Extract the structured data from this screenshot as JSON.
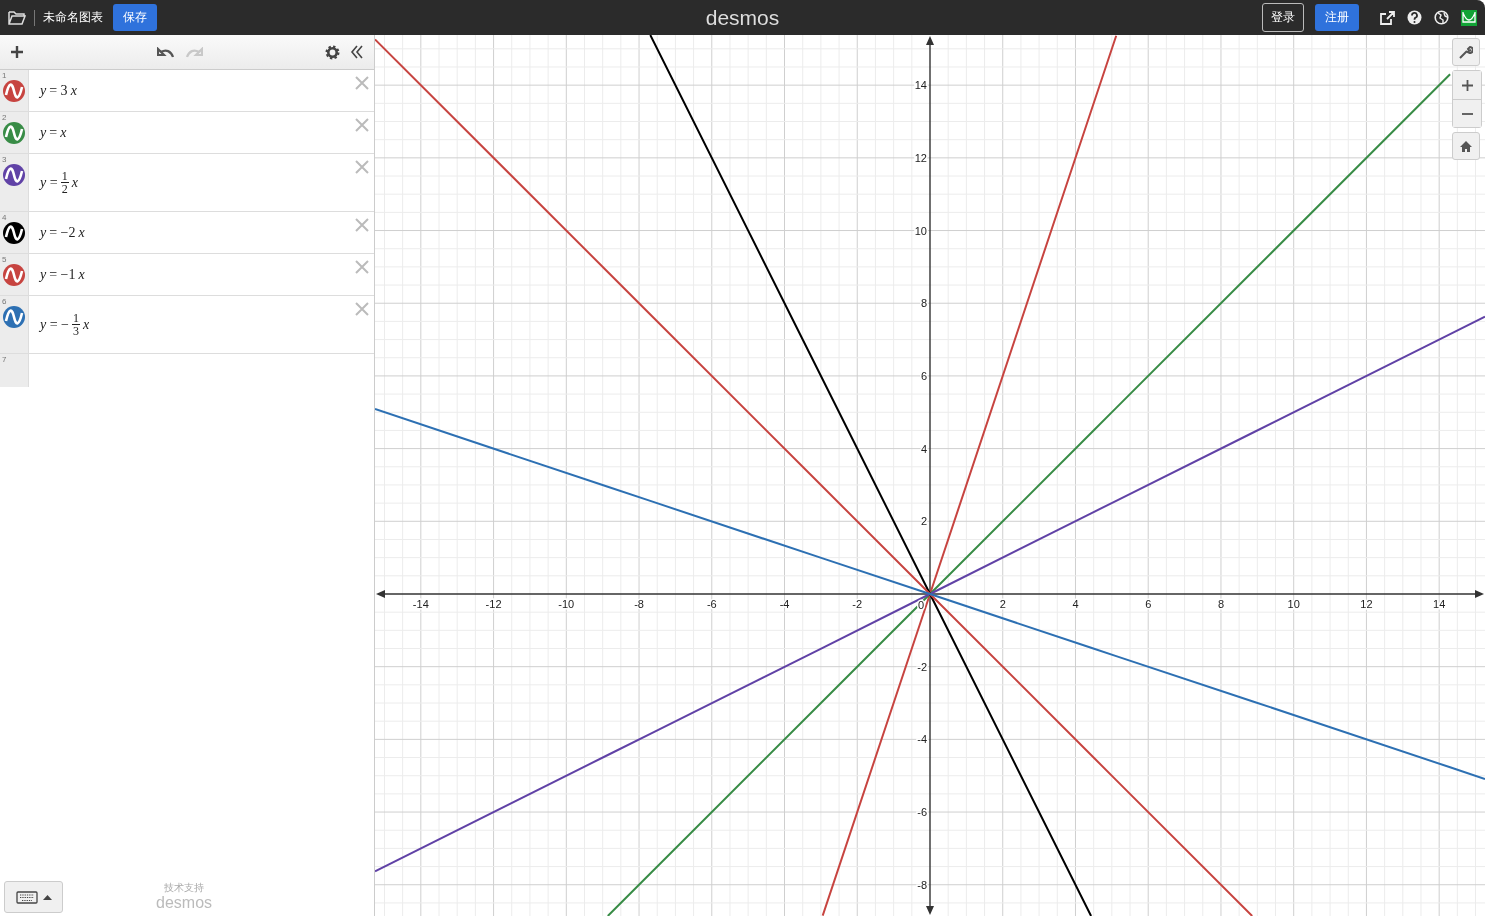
{
  "top_bar": {
    "title": "未命名图表",
    "save_button": "保存",
    "logo": "desmos",
    "login_button": "登录",
    "signup_button": "注册"
  },
  "toolbar": {
    "undo_disabled": false,
    "redo_disabled": true
  },
  "expressions": [
    {
      "index": "1",
      "kind": "plain",
      "color": "#c74440",
      "text": "y = 3x"
    },
    {
      "index": "2",
      "kind": "plain",
      "color": "#388c46",
      "text": "y = x"
    },
    {
      "index": "3",
      "kind": "fraction",
      "color": "#6042a6",
      "prefix": "y =",
      "numerator": "1",
      "denominator": "2",
      "suffix": "x"
    },
    {
      "index": "4",
      "kind": "plain",
      "color": "#000000",
      "text": "y = −2x"
    },
    {
      "index": "5",
      "kind": "plain",
      "color": "#c74440",
      "text": "y = −1x"
    },
    {
      "index": "6",
      "kind": "fraction",
      "color": "#2d70b3",
      "prefix": "y = −",
      "numerator": "1",
      "denominator": "3",
      "suffix": "x"
    },
    {
      "index": "7",
      "kind": "empty"
    }
  ],
  "footer": {
    "powered_by": "技术支持",
    "brand": "desmos"
  },
  "graph": {
    "origin_label": "0",
    "chart_data": {
      "type": "line",
      "grid": true,
      "xlim": [
        -15.26,
        15.26
      ],
      "ylim": [
        -8.86,
        15.38
      ],
      "xticks": [
        {
          "value": -14,
          "label": "-14"
        },
        {
          "value": -12,
          "label": "-12"
        },
        {
          "value": -10,
          "label": "-10"
        },
        {
          "value": -8,
          "label": "-8"
        },
        {
          "value": -6,
          "label": "-6"
        },
        {
          "value": -4,
          "label": "-4"
        },
        {
          "value": -2,
          "label": "-2"
        },
        {
          "value": 2,
          "label": "2"
        },
        {
          "value": 4,
          "label": "4"
        },
        {
          "value": 6,
          "label": "6"
        },
        {
          "value": 8,
          "label": "8"
        },
        {
          "value": 10,
          "label": "10"
        },
        {
          "value": 12,
          "label": "12"
        },
        {
          "value": 14,
          "label": "14"
        }
      ],
      "yticks": [
        {
          "value": -8,
          "label": "-8"
        },
        {
          "value": -6,
          "label": "-6"
        },
        {
          "value": -4,
          "label": "-4"
        },
        {
          "value": -2,
          "label": "-2"
        },
        {
          "value": 2,
          "label": "2"
        },
        {
          "value": 4,
          "label": "4"
        },
        {
          "value": 6,
          "label": "6"
        },
        {
          "value": 8,
          "label": "8"
        },
        {
          "value": 10,
          "label": "10"
        },
        {
          "value": 12,
          "label": "12"
        },
        {
          "value": 14,
          "label": "14"
        }
      ],
      "x": [
        -15.26,
        -8.86,
        -7.69,
        -2.95,
        0,
        4.43,
        5.12,
        8.86,
        14.3,
        15.26
      ],
      "series": [
        {
          "color": "#c74440",
          "values": [
            null,
            null,
            null,
            -8.85,
            0,
            13.29,
            15.36,
            null,
            null,
            null
          ]
        },
        {
          "color": "#388c46",
          "values": [
            null,
            -8.86,
            -7.69,
            -2.95,
            0,
            4.43,
            5.12,
            8.86,
            14.3,
            null
          ]
        },
        {
          "color": "#6042a6",
          "values": [
            -7.63,
            -4.43,
            -3.85,
            -1.48,
            0,
            2.22,
            2.56,
            4.43,
            7.15,
            7.63
          ]
        },
        {
          "color": "#000000",
          "values": [
            null,
            null,
            15.38,
            5.9,
            0,
            -8.86,
            null,
            null,
            null,
            null
          ]
        },
        {
          "color": "#c74440",
          "values": [
            15.26,
            8.86,
            7.69,
            2.95,
            0,
            -4.43,
            -5.12,
            -8.86,
            null,
            null
          ]
        },
        {
          "color": "#2d70b3",
          "values": [
            5.09,
            2.95,
            2.56,
            0.98,
            0,
            -1.48,
            -1.71,
            -2.95,
            -4.77,
            -5.09
          ]
        }
      ]
    }
  }
}
